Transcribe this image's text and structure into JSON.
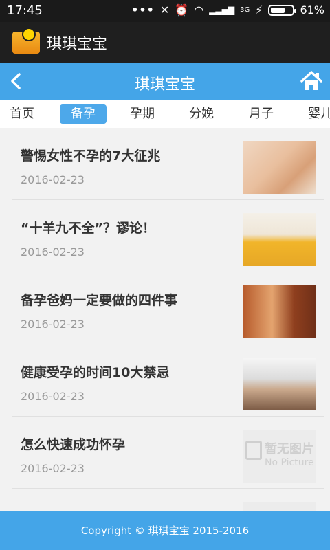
{
  "status_bar": {
    "time": "17:45",
    "network": "3G",
    "battery": "61%"
  },
  "app": {
    "title": "琪琪宝宝"
  },
  "header": {
    "title": "琪琪宝宝",
    "back_icon": "chevron-left-icon",
    "home_icon": "home-icon"
  },
  "tabs": [
    {
      "label": "首页",
      "active": false
    },
    {
      "label": "备孕",
      "active": true
    },
    {
      "label": "孕期",
      "active": false
    },
    {
      "label": "分娩",
      "active": false
    },
    {
      "label": "月子",
      "active": false
    },
    {
      "label": "婴儿",
      "active": false
    }
  ],
  "articles": [
    {
      "title": "警惕女性不孕的7大征兆",
      "date": "2016-02-23"
    },
    {
      "title": "“十羊九不全”？谬论！",
      "date": "2016-02-23"
    },
    {
      "title": "备孕爸妈一定要做的四件事",
      "date": "2016-02-23"
    },
    {
      "title": "健康受孕的时间10大禁忌",
      "date": "2016-02-23"
    },
    {
      "title": "怎么快速成功怀孕",
      "date": "2016-02-23",
      "thumb_text": "暂无图片",
      "thumb_subtext": "No Picture"
    }
  ],
  "footer": {
    "copyright": "Copyright © 琪琪宝宝 2015-2016"
  },
  "colors": {
    "accent": "#44a5e8",
    "status_bar_bg": "#1a1a1a",
    "app_bar_bg": "#1f1f1f"
  }
}
